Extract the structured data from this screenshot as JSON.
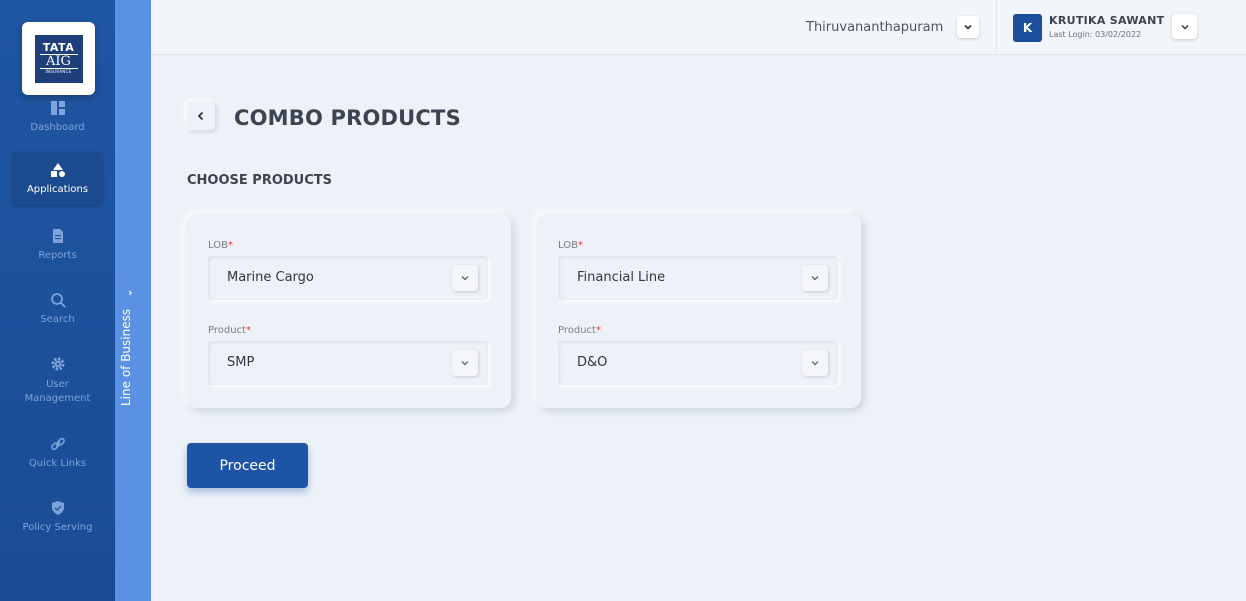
{
  "logo": {
    "line1": "TATA",
    "line2": "AIG",
    "line3": "INSURANCE"
  },
  "sidebar": {
    "items": [
      {
        "label": "Dashboard",
        "icon": "dashboard-icon"
      },
      {
        "label": "Applications",
        "icon": "applications-icon",
        "active": true
      },
      {
        "label": "Reports",
        "icon": "report-icon"
      },
      {
        "label": "Search",
        "icon": "search-icon"
      },
      {
        "label": "User Management",
        "icon": "gear-icon"
      },
      {
        "label": "Quick Links",
        "icon": "link-icon"
      },
      {
        "label": "Policy Serving",
        "icon": "shield-icon"
      }
    ]
  },
  "lob_panel": {
    "label": "Line of Business"
  },
  "header": {
    "location": "Thiruvananthapuram",
    "user": {
      "initial": "K",
      "name": "KRUTIKA SAWANT",
      "last_login": "Last Login: 03/02/2022"
    }
  },
  "main": {
    "title": "COMBO PRODUCTS",
    "section_title": "CHOOSE PRODUCTS",
    "cards": [
      {
        "lob_label": "LOB",
        "lob_value": "Marine Cargo",
        "product_label": "Product",
        "product_value": "SMP"
      },
      {
        "lob_label": "LOB",
        "lob_value": "Financial Line",
        "product_label": "Product",
        "product_value": "D&O"
      }
    ],
    "required_marker": "*",
    "proceed_label": "Proceed"
  },
  "colors": {
    "sidebar": "#1f56a3",
    "lob_strip": "#5b91e3",
    "primary_button": "#1d54a6",
    "required": "#e53935",
    "background": "#eef2f8"
  }
}
